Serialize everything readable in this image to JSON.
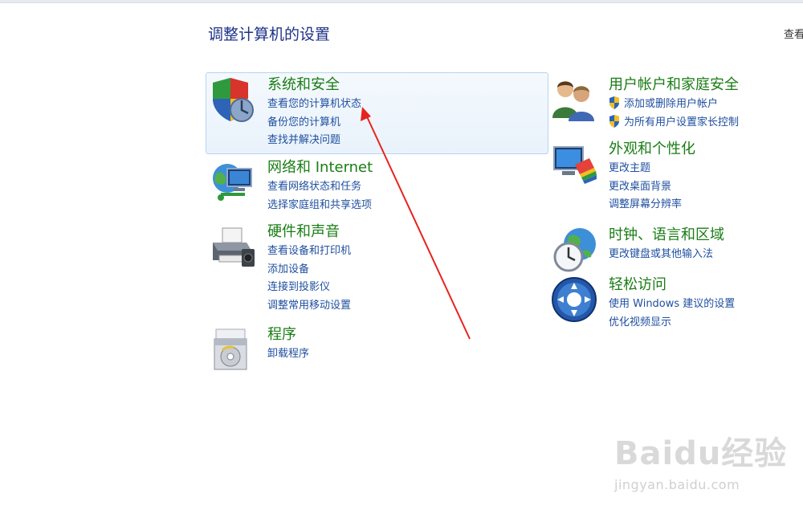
{
  "header": {
    "title": "调整计算机的设置",
    "view_by": "查看"
  },
  "left_categories": [
    {
      "title": "系统和安全",
      "icon": "shield-icon",
      "links": [
        "查看您的计算机状态",
        "备份您的计算机",
        "查找并解决问题"
      ]
    },
    {
      "title": "网络和 Internet",
      "icon": "network-icon",
      "links": [
        "查看网络状态和任务",
        "选择家庭组和共享选项"
      ]
    },
    {
      "title": "硬件和声音",
      "icon": "printer-icon",
      "links": [
        "查看设备和打印机",
        "添加设备",
        "连接到投影仪",
        "调整常用移动设置"
      ]
    },
    {
      "title": "程序",
      "icon": "programs-icon",
      "links": [
        "卸载程序"
      ]
    }
  ],
  "right_categories": [
    {
      "title": "用户帐户和家庭安全",
      "icon": "users-icon",
      "links": [
        "添加或删除用户帐户",
        "为所有用户设置家长控制"
      ],
      "uac_shield_links": true
    },
    {
      "title": "外观和个性化",
      "icon": "display-icon",
      "links": [
        "更改主题",
        "更改桌面背景",
        "调整屏幕分辨率"
      ]
    },
    {
      "title": "时钟、语言和区域",
      "icon": "globe-clock-icon",
      "links": [
        "更改键盘或其他输入法"
      ]
    },
    {
      "title": "轻松访问",
      "icon": "ease-of-access-icon",
      "links": [
        "使用 Windows 建议的设置",
        "优化视频显示"
      ]
    }
  ],
  "annotation": {
    "color": "#e8231f",
    "arrow_target": "查看您的计算机状态"
  },
  "watermark": {
    "logo": "Baidu经验",
    "url": "jingyan.baidu.com"
  }
}
